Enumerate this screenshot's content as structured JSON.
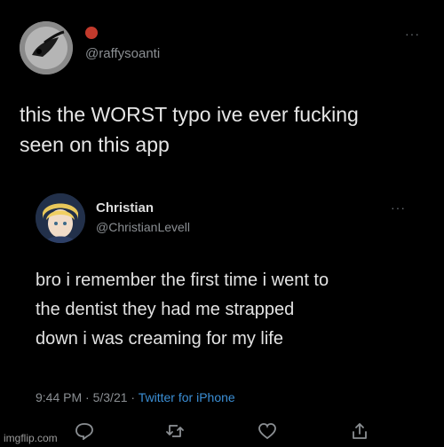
{
  "tweet": {
    "handle": "@raffysoanti",
    "text": "this the WORST typo ive ever fucking\nseen on this app",
    "more_label": "···",
    "badge_color": "#c23a2c"
  },
  "quoted": {
    "name": "Christian",
    "handle": "@ChristianLevell",
    "text": "bro i remember the first time i went to\nthe dentist they had me strapped\ndown i was creaming for my life",
    "more_label": "···",
    "time": "9:44 PM",
    "date": "5/3/21",
    "source": "Twitter for iPhone",
    "separator": "·"
  },
  "actions": {
    "reply_icon": "reply-icon",
    "retweet_icon": "retweet-icon",
    "like_icon": "like-icon",
    "share_icon": "share-icon"
  },
  "watermark": "imgflip.com",
  "colors": {
    "background": "#000000",
    "text": "#e6e6e6",
    "muted": "#8b8f93",
    "link": "#3b8fd6"
  }
}
